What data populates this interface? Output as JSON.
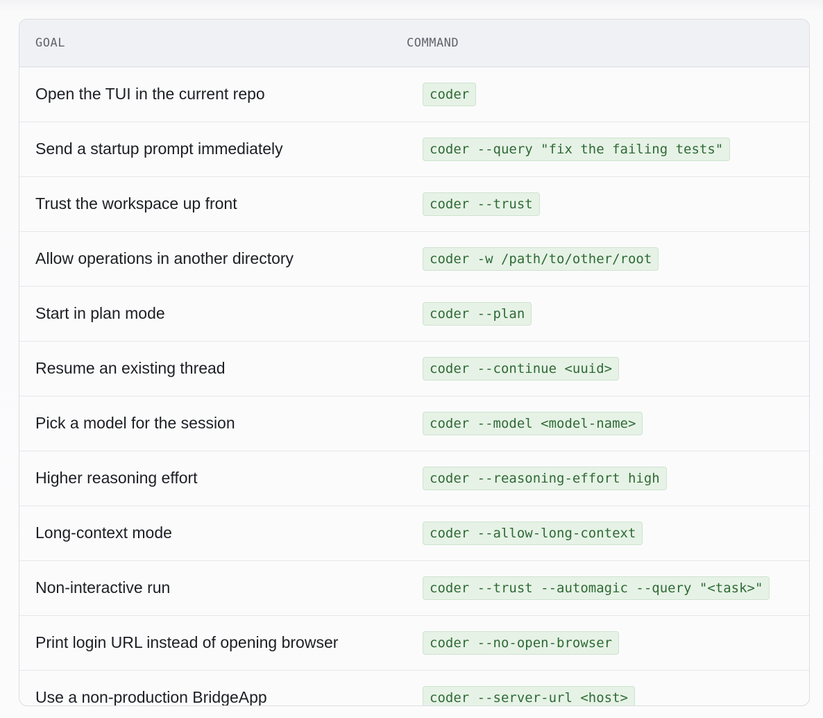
{
  "table": {
    "headers": {
      "goal": "GOAL",
      "command": "COMMAND"
    },
    "rows": [
      {
        "goal": "Open the TUI in the current repo",
        "command": "coder"
      },
      {
        "goal": "Send a startup prompt immediately",
        "command": "coder --query \"fix the failing tests\""
      },
      {
        "goal": "Trust the workspace up front",
        "command": "coder --trust"
      },
      {
        "goal": "Allow operations in another directory",
        "command": "coder -w /path/to/other/root"
      },
      {
        "goal": "Start in plan mode",
        "command": "coder --plan"
      },
      {
        "goal": "Resume an existing thread",
        "command": "coder --continue <uuid>"
      },
      {
        "goal": "Pick a model for the session",
        "command": "coder --model <model-name>"
      },
      {
        "goal": "Higher reasoning effort",
        "command": "coder --reasoning-effort high"
      },
      {
        "goal": "Long-context mode",
        "command": "coder --allow-long-context"
      },
      {
        "goal": "Non-interactive run",
        "command": "coder --trust --automagic --query \"<task>\""
      },
      {
        "goal": "Print login URL instead of opening browser",
        "command": "coder --no-open-browser"
      },
      {
        "goal": "Use a non-production BridgeApp",
        "command": "coder --server-url <host>"
      }
    ]
  },
  "colors": {
    "code_text": "#2f6a35",
    "code_background": "#e6f2e6",
    "header_background": "#f0f1f4"
  }
}
